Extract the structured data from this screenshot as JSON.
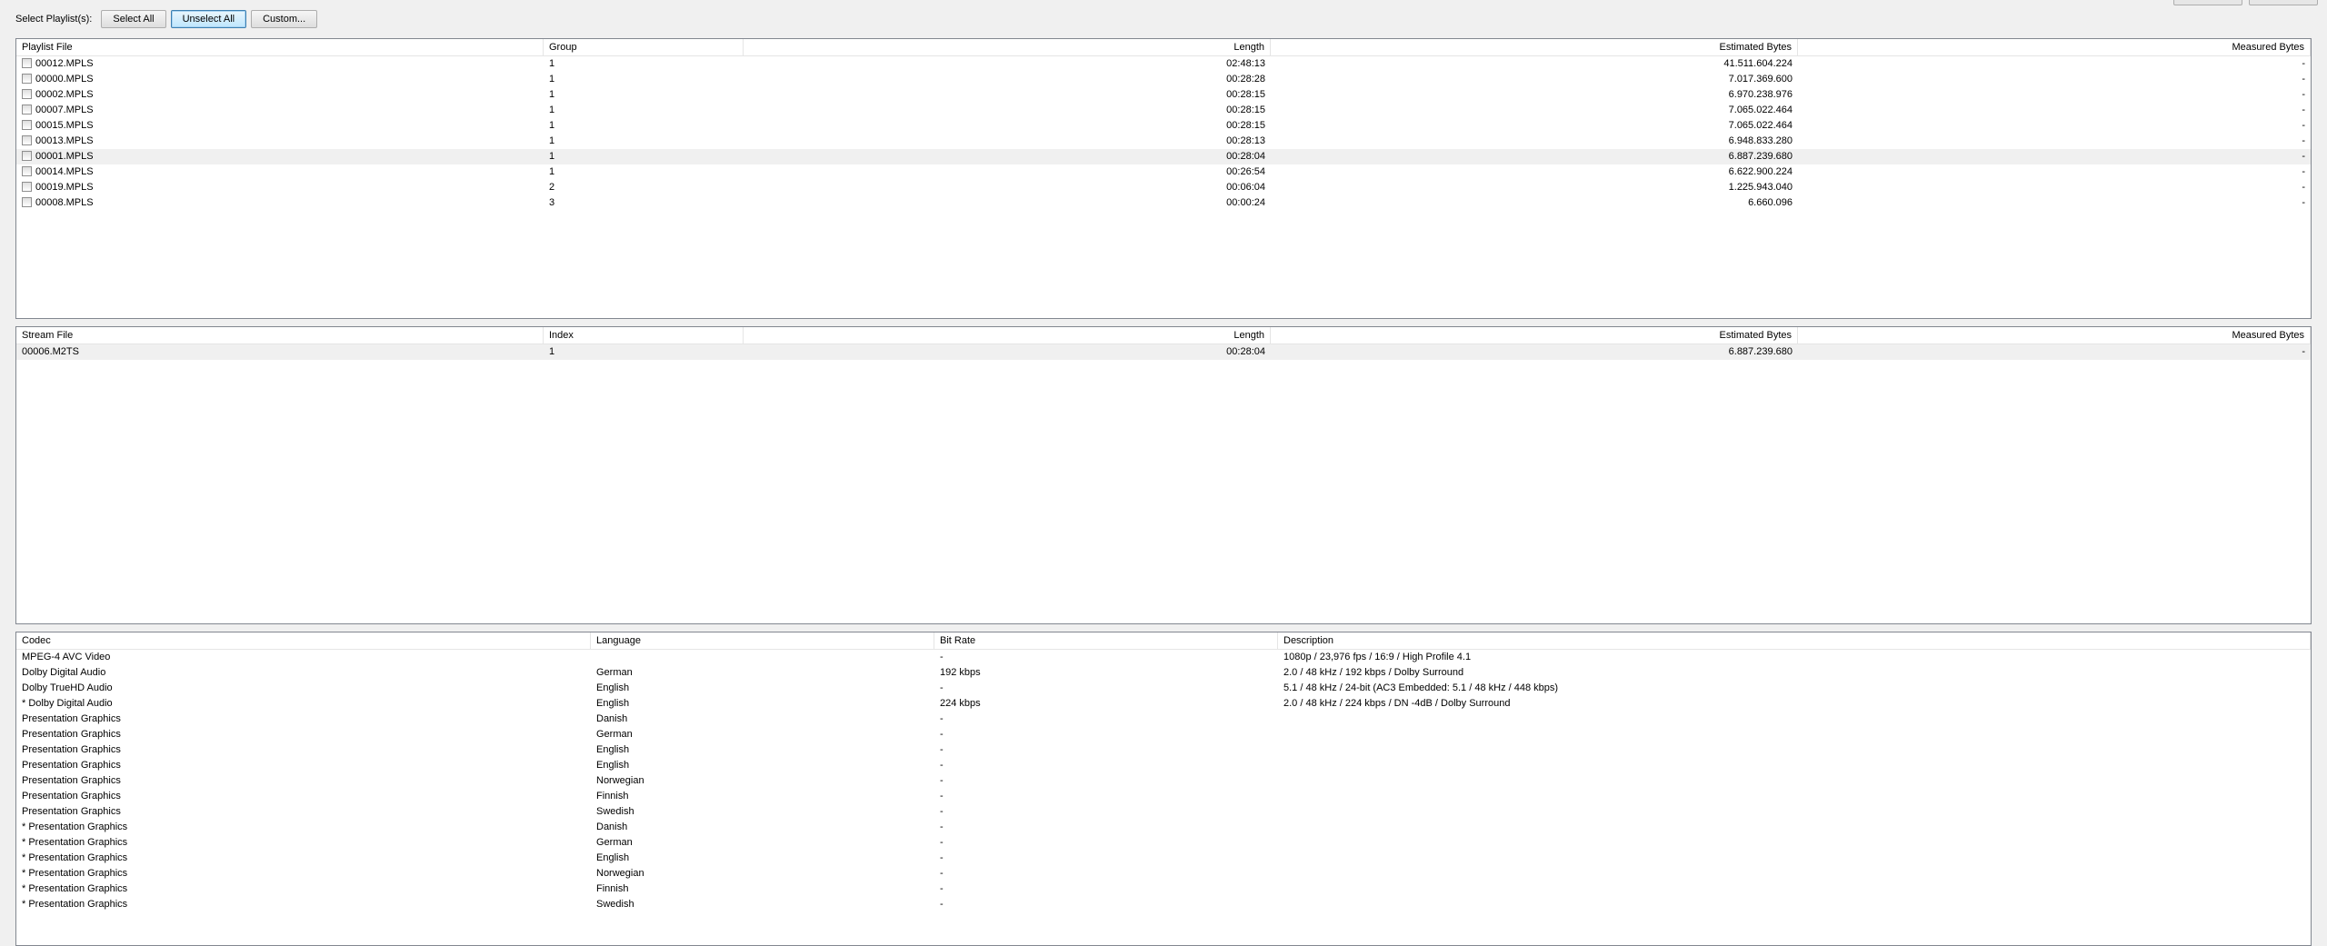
{
  "toolbar": {
    "label": "Select Playlist(s):",
    "select_all": "Select All",
    "unselect_all": "Unselect All",
    "custom": "Custom..."
  },
  "playlists": {
    "headers": [
      "Playlist File",
      "Group",
      "Length",
      "Estimated Bytes",
      "Measured Bytes"
    ],
    "rows": [
      {
        "file": "00012.MPLS",
        "group": "1",
        "length": "02:48:13",
        "est": "41.511.604.224",
        "meas": "-"
      },
      {
        "file": "00000.MPLS",
        "group": "1",
        "length": "00:28:28",
        "est": "7.017.369.600",
        "meas": "-"
      },
      {
        "file": "00002.MPLS",
        "group": "1",
        "length": "00:28:15",
        "est": "6.970.238.976",
        "meas": "-"
      },
      {
        "file": "00007.MPLS",
        "group": "1",
        "length": "00:28:15",
        "est": "7.065.022.464",
        "meas": "-"
      },
      {
        "file": "00015.MPLS",
        "group": "1",
        "length": "00:28:15",
        "est": "7.065.022.464",
        "meas": "-"
      },
      {
        "file": "00013.MPLS",
        "group": "1",
        "length": "00:28:13",
        "est": "6.948.833.280",
        "meas": "-"
      },
      {
        "file": "00001.MPLS",
        "group": "1",
        "length": "00:28:04",
        "est": "6.887.239.680",
        "meas": "-"
      },
      {
        "file": "00014.MPLS",
        "group": "1",
        "length": "00:26:54",
        "est": "6.622.900.224",
        "meas": "-"
      },
      {
        "file": "00019.MPLS",
        "group": "2",
        "length": "00:06:04",
        "est": "1.225.943.040",
        "meas": "-"
      },
      {
        "file": "00008.MPLS",
        "group": "3",
        "length": "00:00:24",
        "est": "6.660.096",
        "meas": "-"
      }
    ]
  },
  "streams": {
    "headers": [
      "Stream File",
      "Index",
      "Length",
      "Estimated Bytes",
      "Measured Bytes"
    ],
    "rows": [
      {
        "file": "00006.M2TS",
        "index": "1",
        "length": "00:28:04",
        "est": "6.887.239.680",
        "meas": "-"
      }
    ]
  },
  "codecs": {
    "headers": [
      "Codec",
      "Language",
      "Bit Rate",
      "Description"
    ],
    "rows": [
      {
        "codec": "MPEG-4 AVC Video",
        "lang": "",
        "rate": "-",
        "desc": "1080p / 23,976 fps / 16:9 / High Profile 4.1"
      },
      {
        "codec": "Dolby Digital Audio",
        "lang": "German",
        "rate": "192 kbps",
        "desc": "2.0 / 48 kHz / 192 kbps / Dolby Surround"
      },
      {
        "codec": "Dolby TrueHD Audio",
        "lang": "English",
        "rate": "-",
        "desc": "5.1 / 48 kHz / 24-bit (AC3 Embedded: 5.1 / 48 kHz / 448 kbps)"
      },
      {
        "codec": "* Dolby Digital Audio",
        "lang": "English",
        "rate": "224 kbps",
        "desc": "2.0 / 48 kHz / 224 kbps / DN -4dB / Dolby Surround"
      },
      {
        "codec": "Presentation Graphics",
        "lang": "Danish",
        "rate": "-",
        "desc": ""
      },
      {
        "codec": "Presentation Graphics",
        "lang": "German",
        "rate": "-",
        "desc": ""
      },
      {
        "codec": "Presentation Graphics",
        "lang": "English",
        "rate": "-",
        "desc": ""
      },
      {
        "codec": "Presentation Graphics",
        "lang": "English",
        "rate": "-",
        "desc": ""
      },
      {
        "codec": "Presentation Graphics",
        "lang": "Norwegian",
        "rate": "-",
        "desc": ""
      },
      {
        "codec": "Presentation Graphics",
        "lang": "Finnish",
        "rate": "-",
        "desc": ""
      },
      {
        "codec": "Presentation Graphics",
        "lang": "Swedish",
        "rate": "-",
        "desc": ""
      },
      {
        "codec": "* Presentation Graphics",
        "lang": "Danish",
        "rate": "-",
        "desc": ""
      },
      {
        "codec": "* Presentation Graphics",
        "lang": "German",
        "rate": "-",
        "desc": ""
      },
      {
        "codec": "* Presentation Graphics",
        "lang": "English",
        "rate": "-",
        "desc": ""
      },
      {
        "codec": "* Presentation Graphics",
        "lang": "Norwegian",
        "rate": "-",
        "desc": ""
      },
      {
        "codec": "* Presentation Graphics",
        "lang": "Finnish",
        "rate": "-",
        "desc": ""
      },
      {
        "codec": "* Presentation Graphics",
        "lang": "Swedish",
        "rate": "-",
        "desc": ""
      }
    ]
  }
}
